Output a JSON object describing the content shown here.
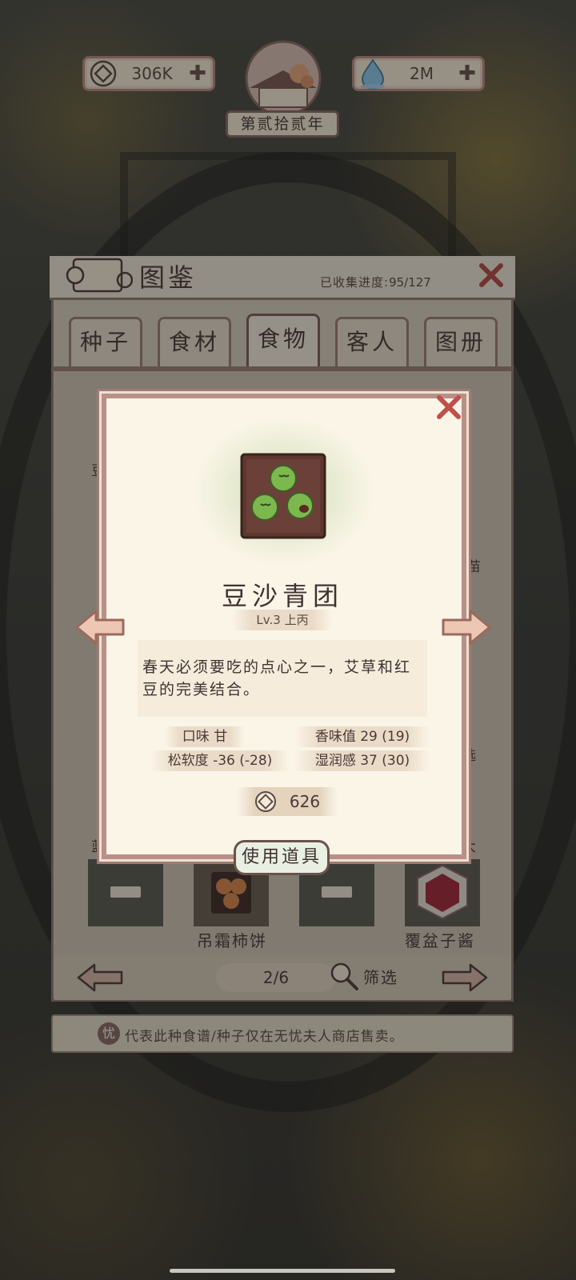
{
  "topbar": {
    "coins": "306K",
    "water": "2M",
    "year_label": "第贰拾贰年"
  },
  "codex": {
    "title": "图鉴",
    "progress_label": "已收集进度:",
    "progress_value": "95/127",
    "tabs": [
      "种子",
      "食材",
      "食物",
      "客人",
      "图册"
    ],
    "active_tab": "食物",
    "partial_labels": [
      "豆",
      "苗",
      "选",
      "蓝",
      "大"
    ],
    "visible_items": [
      "吊霜柿饼",
      "覆盆子酱"
    ],
    "page": "2/6",
    "filter_label": "筛选",
    "notice_badge": "忧",
    "notice": "代表此种食谱/种子仅在无忧夫人商店售卖。"
  },
  "detail": {
    "name": "豆沙青团",
    "level": "Lv.3  上丙",
    "description": "春天必须要吃的点心之一，艾草和红豆的完美结合。",
    "stats": {
      "taste": "口味 甘",
      "aroma": "香味值 29 (19)",
      "softness": "松软度 -36 (-28)",
      "moisture": "湿润感 37 (30)"
    },
    "price": "626",
    "use_button": "使用道具"
  },
  "colors": {
    "card_border": "#b99088",
    "close_red": "#c0504a",
    "qingtuan_green": "#7db84f"
  }
}
